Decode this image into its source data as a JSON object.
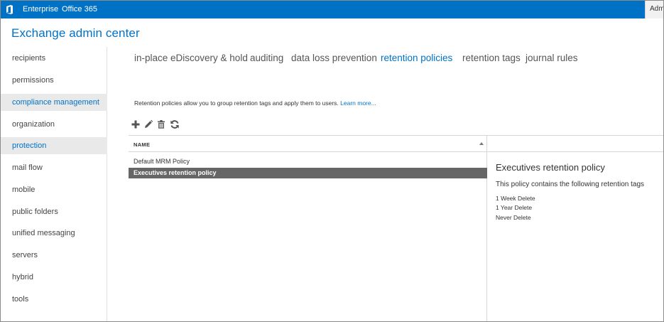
{
  "topbar": {
    "brand_color": "#0072c6",
    "logo_icon": "office-logo-icon",
    "links": [
      "Enterprise",
      "Office 365"
    ],
    "user_label": "Admi"
  },
  "app_title": "Exchange admin center",
  "leftnav": {
    "items": [
      {
        "label": "recipients",
        "selected": false
      },
      {
        "label": "permissions",
        "selected": false
      },
      {
        "label": "compliance management",
        "selected": true
      },
      {
        "label": "organization",
        "selected": false
      },
      {
        "label": "protection",
        "selected": true
      },
      {
        "label": "mail flow",
        "selected": false
      },
      {
        "label": "mobile",
        "selected": false
      },
      {
        "label": "public folders",
        "selected": false
      },
      {
        "label": "unified messaging",
        "selected": false
      },
      {
        "label": "servers",
        "selected": false
      },
      {
        "label": "hybrid",
        "selected": false
      },
      {
        "label": "tools",
        "selected": false
      }
    ]
  },
  "tabs": [
    {
      "label": "in-place eDiscovery & hold",
      "active": false
    },
    {
      "label": "auditing",
      "active": false
    },
    {
      "label": "data loss prevention",
      "active": false
    },
    {
      "label": "retention policies",
      "active": true
    },
    {
      "label": "retention tags",
      "active": false
    },
    {
      "label": "journal rules",
      "active": false
    }
  ],
  "description": {
    "text": "Retention policies allow you to group retention tags and apply them to users.",
    "link": "Learn more..."
  },
  "toolbar": {
    "icons": [
      "add-icon",
      "edit-icon",
      "delete-icon",
      "refresh-icon"
    ]
  },
  "list": {
    "column_header": "NAME",
    "sort": "ascending",
    "rows": [
      {
        "name": "Default MRM Policy",
        "selected": false
      },
      {
        "name": "Executives retention policy",
        "selected": true
      }
    ]
  },
  "details": {
    "title": "Executives retention policy",
    "subtitle": "This policy contains the following retention tags",
    "tags": [
      "1 Week Delete",
      "1 Year Delete",
      "Never Delete"
    ]
  }
}
